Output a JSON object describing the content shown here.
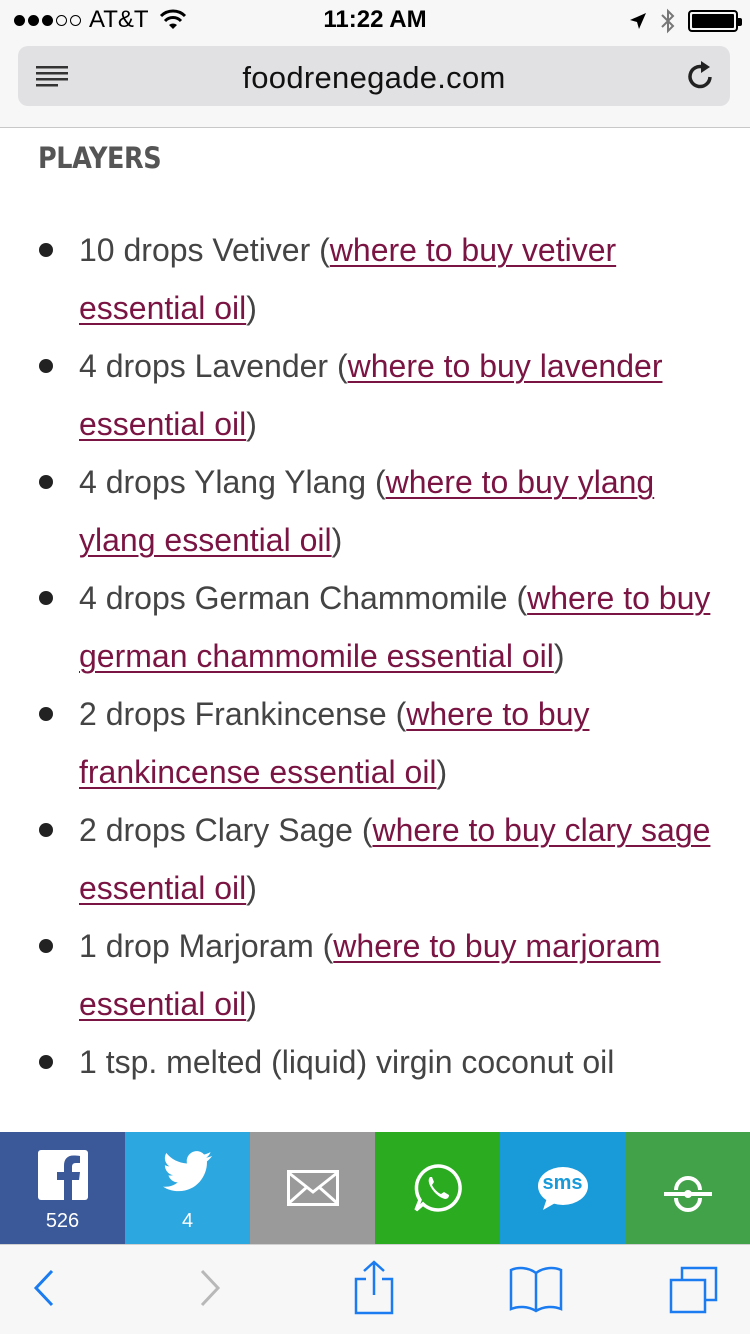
{
  "status_bar": {
    "carrier": "AT&T",
    "time": "11:22 AM",
    "signal_bars_filled": 3,
    "signal_bars_total": 5
  },
  "browser": {
    "url": "foodrenegade.com"
  },
  "article": {
    "heading": "PLAYERS",
    "items": [
      {
        "text": "10 drops Vetiver (",
        "link": "where to buy vetiver essential oil",
        "suffix": ")"
      },
      {
        "text": "4 drops Lavender (",
        "link": "where to buy lavender essential oil",
        "suffix": ")"
      },
      {
        "text": "4 drops Ylang Ylang (",
        "link": "where to buy ylang ylang essential oil",
        "suffix": ")"
      },
      {
        "text": "4 drops German Chammomile (",
        "link": "where to buy german chammomile essential oil",
        "suffix": ")"
      },
      {
        "text": "2 drops Frankincense (",
        "link": "where to buy frankincense essential oil",
        "suffix": ")"
      },
      {
        "text": "2 drops Clary Sage (",
        "link": "where to buy clary sage essential oil",
        "suffix": ")"
      },
      {
        "text": "1 drop Marjoram (",
        "link": "where to buy marjoram essential oil",
        "suffix": ")"
      },
      {
        "text": "1 tsp. melted (liquid) virgin coconut oil",
        "link": "",
        "suffix": ""
      }
    ]
  },
  "share_bar": {
    "facebook_count": "526",
    "twitter_count": "4",
    "sms_label": "sms",
    "colors": {
      "facebook": "#3b5998",
      "twitter": "#2ca7e0",
      "email": "#9a9a9a",
      "whatsapp": "#2aab20",
      "sms": "#199ad9",
      "more": "#42a24a"
    }
  },
  "colors": {
    "link": "#7a1442",
    "body_text": "#444444",
    "ios_blue": "#1a7cf0"
  },
  "toolbar_icons": [
    "back-icon",
    "forward-icon",
    "share-icon",
    "bookmarks-icon",
    "tabs-icon"
  ]
}
